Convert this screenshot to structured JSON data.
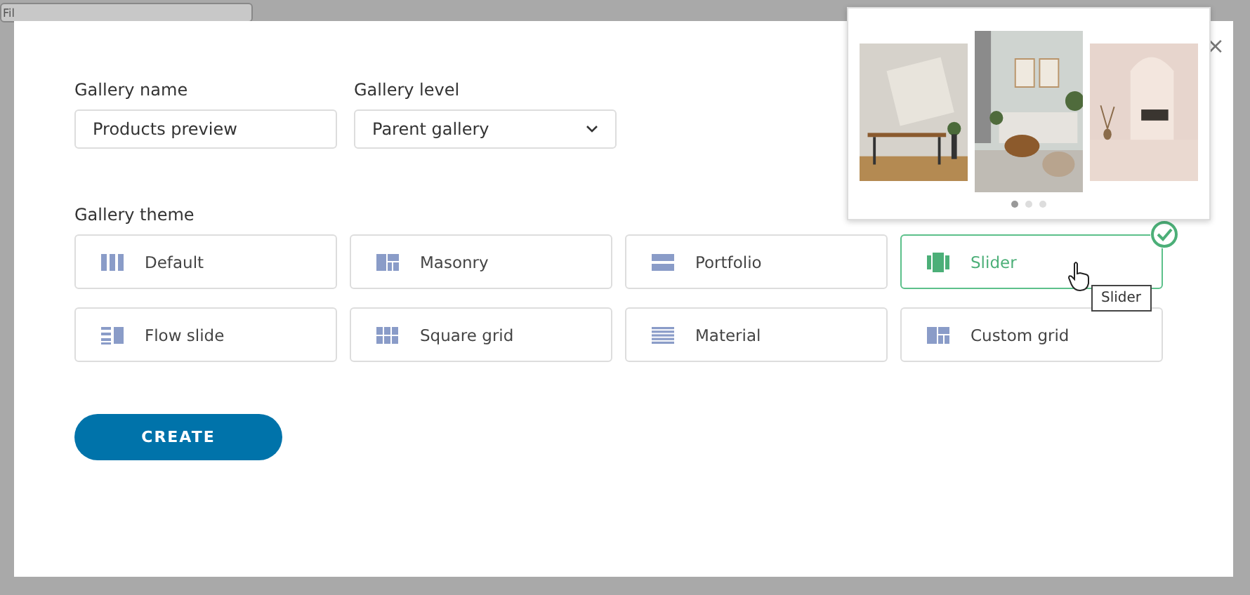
{
  "background": {
    "fragments": [
      {
        "kind": "field",
        "text": "Fil"
      }
    ]
  },
  "form": {
    "name": {
      "label": "Gallery name",
      "value": "Products preview"
    },
    "level": {
      "label": "Gallery level",
      "value": "Parent gallery"
    }
  },
  "theme": {
    "label": "Gallery theme",
    "options": [
      {
        "label": "Default",
        "kind": "columns",
        "selected": false
      },
      {
        "label": "Masonry",
        "kind": "masonry",
        "selected": false
      },
      {
        "label": "Portfolio",
        "kind": "portfolio",
        "selected": false
      },
      {
        "label": "Slider",
        "kind": "slider",
        "selected": true
      },
      {
        "label": "Flow slide",
        "kind": "flow",
        "selected": false
      },
      {
        "label": "Square grid",
        "kind": "squares",
        "selected": false
      },
      {
        "label": "Material",
        "kind": "material",
        "selected": false
      },
      {
        "label": "Custom grid",
        "kind": "custom",
        "selected": false
      }
    ]
  },
  "tooltip": "Slider",
  "create": "CREATE",
  "close": "×",
  "preview": {
    "dots": [
      {
        "selected": true
      },
      {
        "selected": false
      },
      {
        "selected": false
      }
    ]
  }
}
